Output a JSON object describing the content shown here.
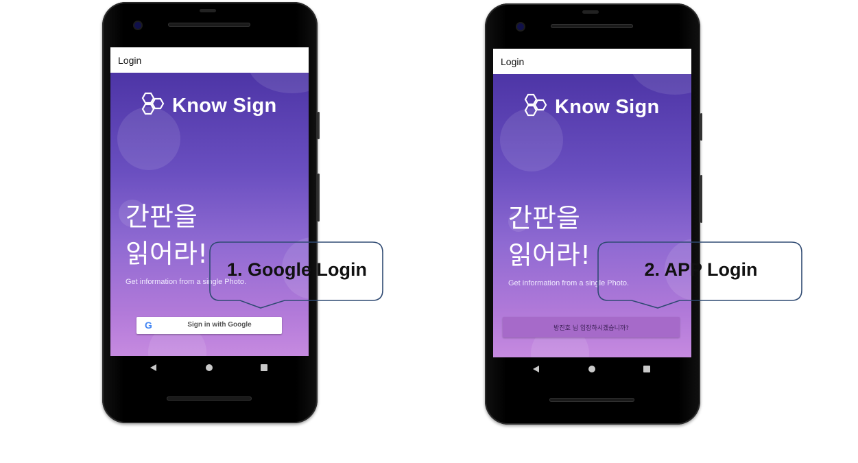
{
  "phones": [
    {
      "appbar_title": "Login",
      "logo_text": "Know Sign",
      "headline_line1": "간판을",
      "headline_line2": "읽어라!",
      "subtitle": "Get information from a single Photo.",
      "google_button_label": "Sign in with Google",
      "google_icon": "G"
    },
    {
      "appbar_title": "Login",
      "logo_text": "Know Sign",
      "headline_line1": "간판을",
      "headline_line2": "읽어라!",
      "subtitle": "Get information from a single Photo.",
      "app_button_label": "방진호 님 입장하시겠습니까?"
    }
  ],
  "callouts": [
    {
      "text": "1. Google Login"
    },
    {
      "text": "2. APP Login"
    }
  ],
  "nav_icons": [
    "back-icon",
    "home-icon",
    "recent-apps-icon"
  ],
  "colors": {
    "gradient_top": "#4d35a6",
    "gradient_bottom": "#c68ae0",
    "callout_border": "#2f4a72",
    "app_button": "#a66ac9"
  }
}
